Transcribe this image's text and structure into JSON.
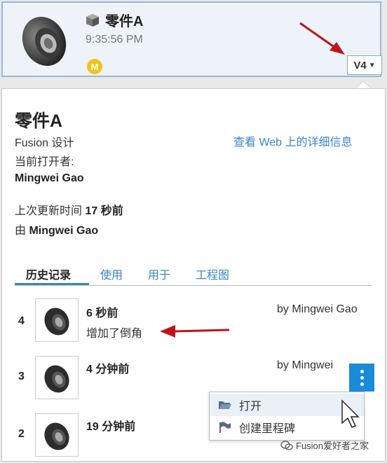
{
  "file": {
    "name": "零件A",
    "time": "9:35:56 PM",
    "user_badge": "M",
    "version": "V4",
    "colors": {
      "badge": "#f0c419",
      "card_border": "#9cb6d8"
    }
  },
  "details": {
    "title": "零件A",
    "type": "Fusion 设计",
    "web_link": "查看 Web 上的详细信息",
    "open_by_label": "当前打开者:",
    "open_by_name": "Mingwei Gao",
    "updated_label": "上次更新时间",
    "updated_value": "17 秒前",
    "by_label": "由",
    "by_name": "Mingwei Gao"
  },
  "tabs": [
    {
      "label": "历史记录",
      "active": true
    },
    {
      "label": "使用",
      "active": false
    },
    {
      "label": "用于",
      "active": false
    },
    {
      "label": "工程图",
      "active": false
    }
  ],
  "history": [
    {
      "num": "4",
      "time": "6 秒前",
      "by": "by Mingwei Gao",
      "desc": "增加了倒角"
    },
    {
      "num": "3",
      "time": "4 分钟前",
      "by": "by Mingwei",
      "desc": ""
    },
    {
      "num": "2",
      "time": "19 分钟前",
      "by": "",
      "desc": ""
    }
  ],
  "context_menu": [
    {
      "label": "打开",
      "icon": "folder-open-icon"
    },
    {
      "label": "创建里程碑",
      "icon": "flag-icon"
    }
  ],
  "watermark": "Fusion爱好者之家",
  "accent": "#1b8ad8",
  "link_color": "#3b84c4",
  "annotation_arrow_color": "#c0141b"
}
